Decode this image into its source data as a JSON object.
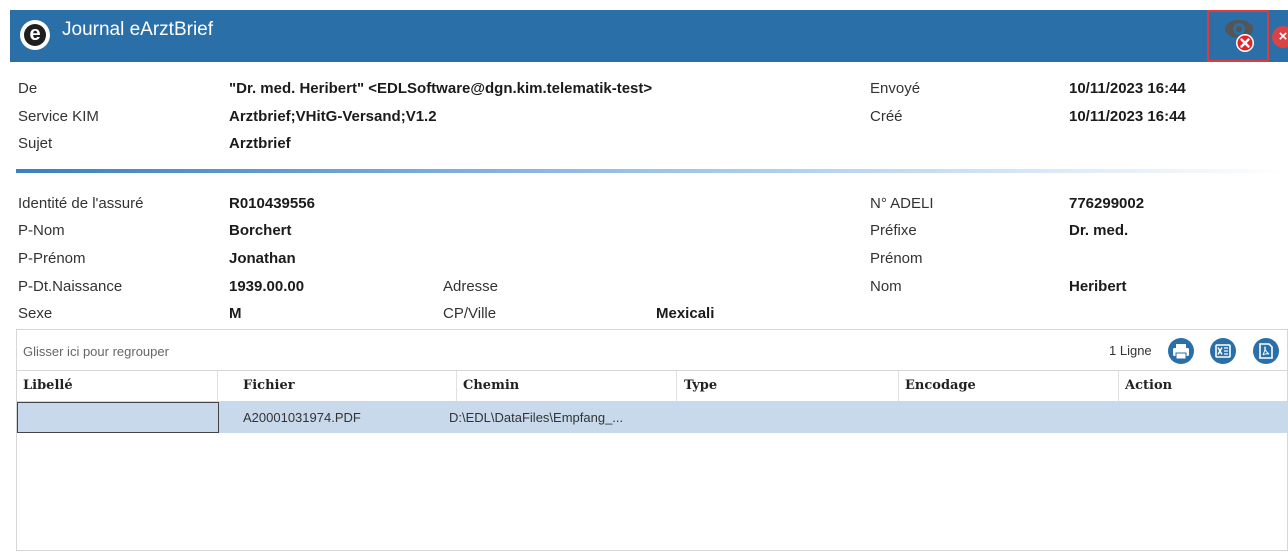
{
  "window": {
    "title": "Journal eArztBrief",
    "logo_letter": "e",
    "close_label": "×"
  },
  "message": {
    "from_label": "De",
    "from_value": "\"Dr. med. Heribert\" <EDLSoftware@dgn.kim.telematik-test>",
    "service_label": "Service KIM",
    "service_value": "Arztbrief;VHitG-Versand;V1.2",
    "subject_label": "Sujet",
    "subject_value": "Arztbrief",
    "sent_label": "Envoyé",
    "sent_value": "10/11/2023 16:44",
    "created_label": "Créé",
    "created_value": "10/11/2023 16:44"
  },
  "patient": {
    "id_label": "Identité de l'assuré",
    "id_value": "R010439556",
    "lastname_label": "P-Nom",
    "lastname_value": "Borchert",
    "firstname_label": "P-Prénom",
    "firstname_value": "Jonathan",
    "birth_label": "P-Dt.Naissance",
    "birth_value": "1939.00.00",
    "sex_label": "Sexe",
    "sex_value": "M",
    "address_label": "Adresse",
    "address_value": "",
    "city_label": "CP/Ville",
    "city_value": "Mexicali"
  },
  "doctor": {
    "adeli_label": "N° ADELI",
    "adeli_value": "776299002",
    "prefix_label": "Préfixe",
    "prefix_value": "Dr. med.",
    "firstname_label": "Prénom",
    "firstname_value": "",
    "name_label": "Nom",
    "name_value": "Heribert"
  },
  "grid": {
    "group_hint": "Glisser ici pour regrouper",
    "count": "1 Ligne",
    "columns": [
      "Libellé",
      "Fichier",
      "Chemin",
      "Type",
      "Encodage",
      "Action"
    ],
    "rows": [
      {
        "libelle": "",
        "fichier": "A20001031974.PDF",
        "chemin": "D:\\EDL\\DataFiles\\Empfang_...",
        "type": "",
        "encodage": "",
        "action": ""
      }
    ]
  },
  "icons": {
    "print": "print-icon",
    "excel": "excel-export-icon",
    "pdf": "pdf-export-icon"
  },
  "colors": {
    "titlebar": "#2a6fa8",
    "selected_row": "#c7d9ea",
    "close": "#d94343"
  }
}
